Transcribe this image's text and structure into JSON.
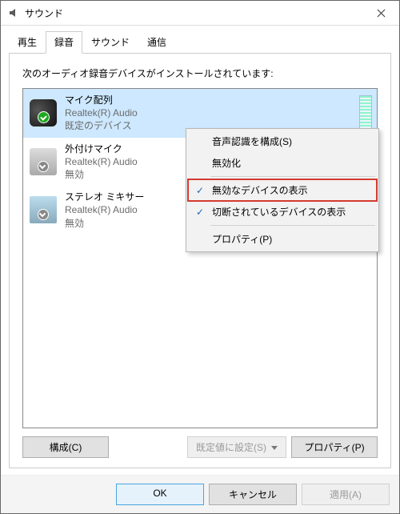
{
  "window": {
    "title": "サウンド"
  },
  "tabs": [
    {
      "label": "再生",
      "active": false
    },
    {
      "label": "録音",
      "active": true
    },
    {
      "label": "サウンド",
      "active": false
    },
    {
      "label": "通信",
      "active": false
    }
  ],
  "panel": {
    "instruction": "次のオーディオ録音デバイスがインストールされています:",
    "devices": [
      {
        "name": "マイク配列",
        "provider": "Realtek(R) Audio",
        "state": "既定のデバイス",
        "selected": true,
        "default": true
      },
      {
        "name": "外付けマイク",
        "provider": "Realtek(R) Audio",
        "state": "無効",
        "selected": false,
        "default": false
      },
      {
        "name": "ステレオ ミキサー",
        "provider": "Realtek(R) Audio",
        "state": "無効",
        "selected": false,
        "default": false
      }
    ],
    "configure_label": "構成(C)",
    "set_default_label": "既定値に設定(S)",
    "properties_label": "プロパティ(P)"
  },
  "context_menu": {
    "items": [
      {
        "label": "音声認識を構成(S)",
        "checked": false
      },
      {
        "label": "無効化",
        "checked": false
      },
      {
        "sep": true
      },
      {
        "label": "無効なデバイスの表示",
        "checked": true,
        "highlight": true
      },
      {
        "label": "切断されているデバイスの表示",
        "checked": true
      },
      {
        "sep": true
      },
      {
        "label": "プロパティ(P)",
        "checked": false
      }
    ]
  },
  "footer": {
    "ok": "OK",
    "cancel": "キャンセル",
    "apply": "適用(A)"
  }
}
